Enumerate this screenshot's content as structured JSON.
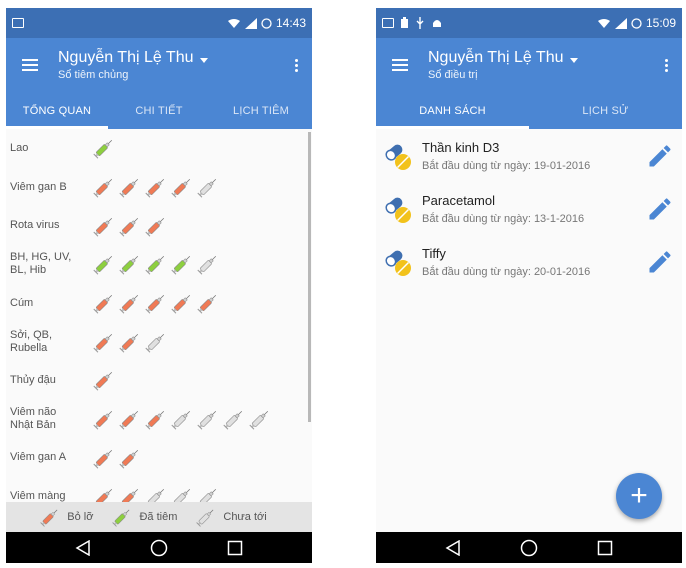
{
  "left": {
    "status_time": "14:43",
    "user_name": "Nguyễn Thị Lệ Thu",
    "subtitle": "Sổ tiêm chủng",
    "tabs": [
      "TỔNG QUAN",
      "CHI TIẾT",
      "LỊCH TIÊM"
    ],
    "active_tab": 0,
    "vaccines": [
      {
        "name": "Lao",
        "doses": [
          "done"
        ]
      },
      {
        "name": "Viêm gan B",
        "doses": [
          "missed",
          "missed",
          "missed",
          "missed",
          "upcoming"
        ]
      },
      {
        "name": "Rota virus",
        "doses": [
          "missed",
          "missed",
          "missed"
        ]
      },
      {
        "name": "BH, HG, UV,\nBL, Hib",
        "doses": [
          "done",
          "done",
          "done",
          "done",
          "upcoming"
        ]
      },
      {
        "name": "Cúm",
        "doses": [
          "missed",
          "missed",
          "missed",
          "missed",
          "missed"
        ]
      },
      {
        "name": "Sởi, QB,\nRubella",
        "doses": [
          "missed",
          "missed",
          "upcoming"
        ]
      },
      {
        "name": "Thủy đậu",
        "doses": [
          "missed"
        ]
      },
      {
        "name": "Viêm não\nNhật Bản",
        "doses": [
          "missed",
          "missed",
          "missed",
          "upcoming",
          "upcoming",
          "upcoming",
          "upcoming"
        ]
      },
      {
        "name": "Viêm gan A",
        "doses": [
          "missed",
          "missed"
        ]
      },
      {
        "name": "Viêm màng",
        "doses": [
          "missed",
          "missed",
          "upcoming",
          "upcoming",
          "upcoming"
        ]
      }
    ],
    "legend": {
      "missed": "Bỏ lỡ",
      "done": "Đã tiêm",
      "upcoming": "Chưa tới"
    }
  },
  "right": {
    "status_time": "15:09",
    "user_name": "Nguyễn Thị Lệ Thu",
    "subtitle": "Sổ điều trị",
    "tabs": [
      "DANH SÁCH",
      "LỊCH SỬ"
    ],
    "active_tab": 0,
    "medicines": [
      {
        "name": "Thần kinh D3",
        "date": "Bắt đầu dùng từ ngày: 19-01-2016"
      },
      {
        "name": "Paracetamol",
        "date": "Bắt đầu dùng từ ngày: 13-1-2016"
      },
      {
        "name": "Tiffy",
        "date": "Bắt đầu dùng từ ngày: 20-01-2016"
      }
    ],
    "fab_label": "+"
  },
  "colors": {
    "primary": "#4b86d3",
    "status": "#3c6fb4",
    "missed": "#f07a55",
    "done": "#8dcf3f",
    "upcoming": "#e0e0e0",
    "pill_blue": "#3f6fb0",
    "pill_yellow": "#f2c21b"
  },
  "icons": {
    "menu": "hamburger-menu-icon",
    "more": "more-vert-icon",
    "syringe": "syringe-icon",
    "pill": "capsule-pill-icon",
    "edit": "pencil-edit-icon",
    "add": "plus-icon"
  }
}
